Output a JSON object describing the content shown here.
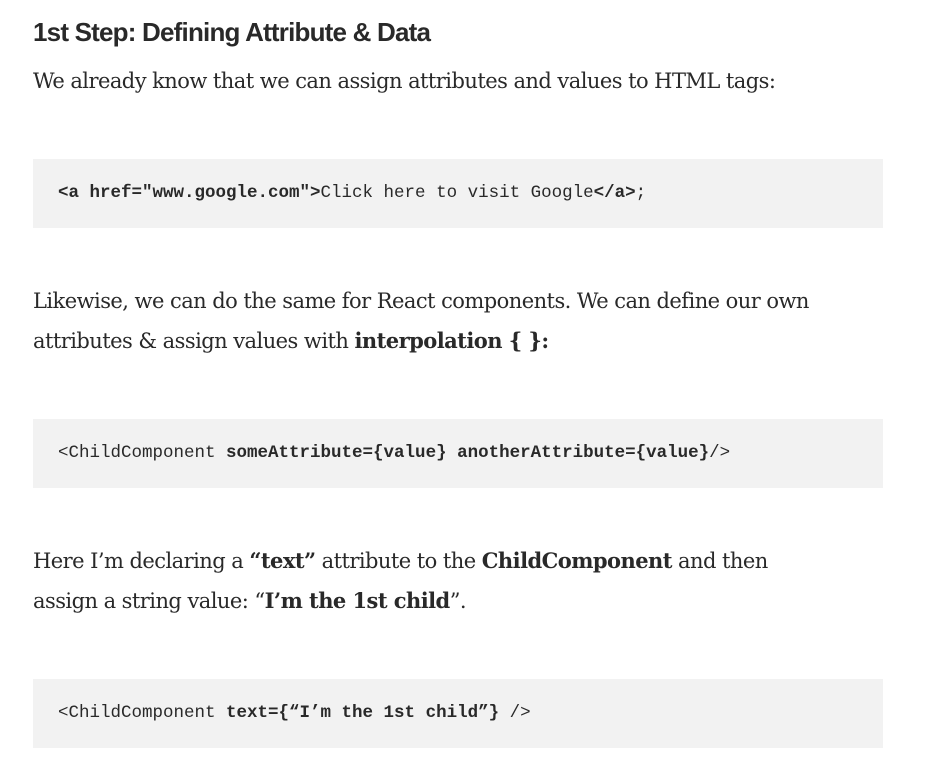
{
  "heading": "1st Step: Defining Attribute & Data",
  "paragraphs": {
    "p1": {
      "text": "We already know that we can assign attributes and values to HTML tags:"
    },
    "p2": {
      "line1": "Likewise, we can do the same for React components. We can define our own",
      "line2_prefix": "attributes & assign values with ",
      "line2_bold": "interpolation { }:"
    },
    "p3": {
      "line1_prefix": "Here I’m declaring a ",
      "line1_bold1": "“text”",
      "line1_mid": " attribute to the ",
      "line1_bold2": "ChildComponent",
      "line1_suffix": " and then",
      "line2_prefix": "assign a string value: “",
      "line2_bold": "I’m the 1st child",
      "line2_suffix": "”."
    }
  },
  "code_blocks": {
    "c1": {
      "tag_open": "<a href=\"www.google.com\">",
      "content": "Click here to visit Google",
      "tag_close": "</a>",
      "end": ";"
    },
    "c2": {
      "open": "<ChildComponent ",
      "attr1": "someAttribute={value}",
      "space": " ",
      "attr2": "anotherAttribute={value}",
      "close": "/>"
    },
    "c3": {
      "open": "<ChildComponent ",
      "attr": "text={“I’m the 1st child”}",
      "close": " />"
    }
  }
}
